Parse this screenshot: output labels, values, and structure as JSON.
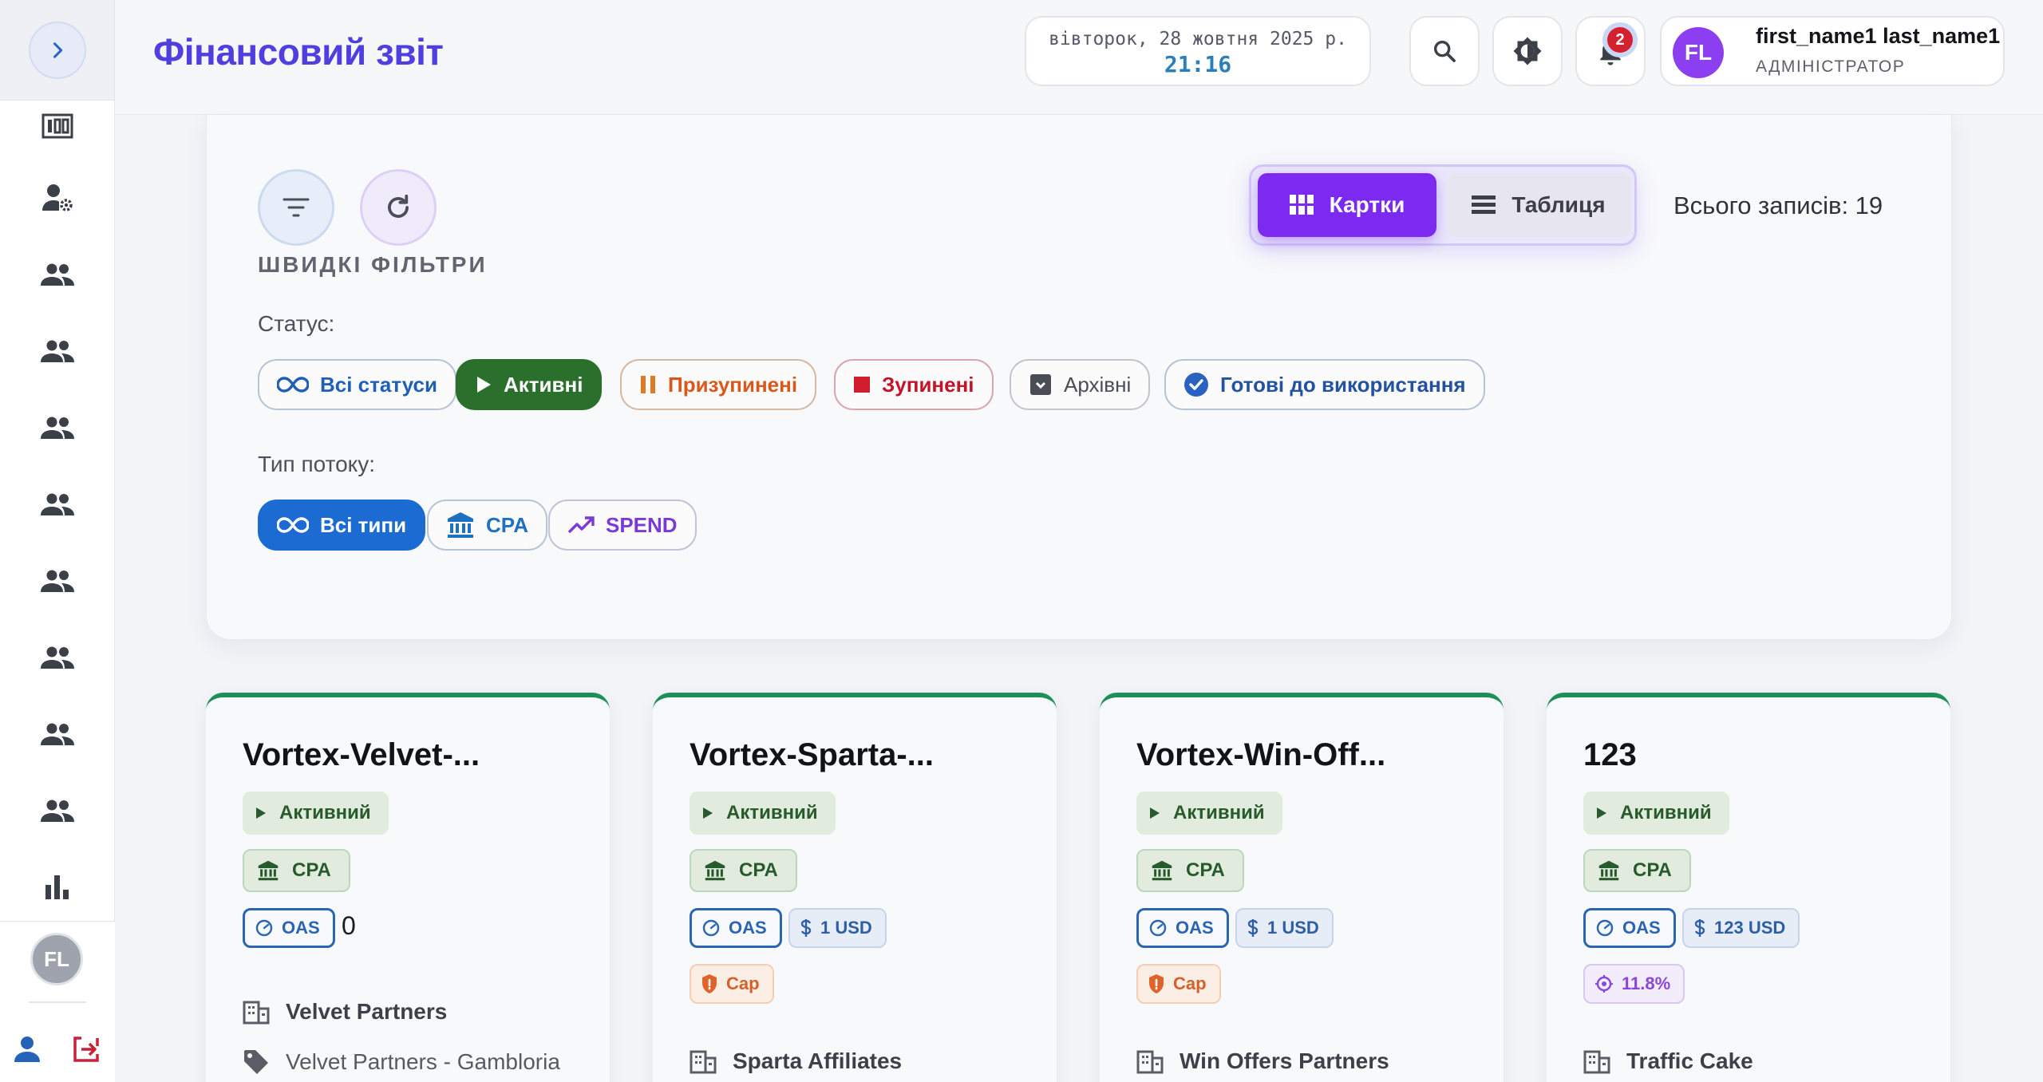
{
  "header": {
    "title": "Фінансовий звіт",
    "date": "вівторок, 28 жовтня 2025 р.",
    "time": "21:16",
    "notifications_count": "2",
    "user": {
      "initials": "FL",
      "name": "first_name1 last_name1",
      "role": "АДМІНІСТРАТОР"
    }
  },
  "sidebar": {
    "nav_icons": [
      "dashboard-icon",
      "user-settings-icon",
      "group-icon",
      "group-icon",
      "group-icon",
      "group-icon",
      "group-icon",
      "group-icon",
      "group-icon",
      "group-icon",
      "bar-chart-icon"
    ],
    "avatar_initials": "FL"
  },
  "filters": {
    "quick_title": "ШВИДКІ ФІЛЬТРИ",
    "status_label": "Статус:",
    "statuses": [
      {
        "label": "Всі статуси",
        "icon": "infinity-icon"
      },
      {
        "label": "Активні",
        "icon": "play-icon"
      },
      {
        "label": "Призупинені",
        "icon": "pause-icon"
      },
      {
        "label": "Зупинені",
        "icon": "stop-icon"
      },
      {
        "label": "Архівні",
        "icon": "archive-icon"
      },
      {
        "label": "Готові до використання",
        "icon": "check-circle-icon"
      }
    ],
    "active_status": "Активні",
    "flow_label": "Тип потоку:",
    "flow_types": [
      {
        "label": "Всі типи",
        "icon": "infinity-icon"
      },
      {
        "label": "CPA",
        "icon": "bank-icon"
      },
      {
        "label": "SPEND",
        "icon": "trending-up-icon"
      }
    ],
    "active_flow_type": "Всі типи",
    "view_cards": "Картки",
    "view_table": "Таблиця",
    "active_view": "Картки",
    "total_records": "Всього записів: 19"
  },
  "colors": {
    "accent_purple": "#7d2af0",
    "title_indigo": "#4f3fe0",
    "status_green": "#2a6f2b",
    "card_top_green": "#1f8f5a",
    "cap_orange": "#d2612c",
    "stopped_red": "#c3142a",
    "link_blue": "#1f5fb8"
  },
  "cards": [
    {
      "title": "Vortex-Velvet-...",
      "status": "Активний",
      "type": "CPA",
      "oas": "OAS",
      "amount": "",
      "amount_plain": "0",
      "extra": "",
      "partner": "Velvet Partners",
      "offer": "Velvet Partners - Gambloria"
    },
    {
      "title": "Vortex-Sparta-...",
      "status": "Активний",
      "type": "CPA",
      "oas": "OAS",
      "amount": "1 USD",
      "amount_plain": "",
      "extra": "Cap",
      "partner": "Sparta Affiliates",
      "offer": ""
    },
    {
      "title": "Vortex-Win-Off...",
      "status": "Активний",
      "type": "CPA",
      "oas": "OAS",
      "amount": "1 USD",
      "amount_plain": "",
      "extra": "Cap",
      "partner": "Win Offers Partners",
      "offer": ""
    },
    {
      "title": "123",
      "status": "Активний",
      "type": "CPA",
      "oas": "OAS",
      "amount": "123 USD",
      "amount_plain": "",
      "extra": "11.8%",
      "partner": "Traffic Cake",
      "offer": ""
    }
  ]
}
